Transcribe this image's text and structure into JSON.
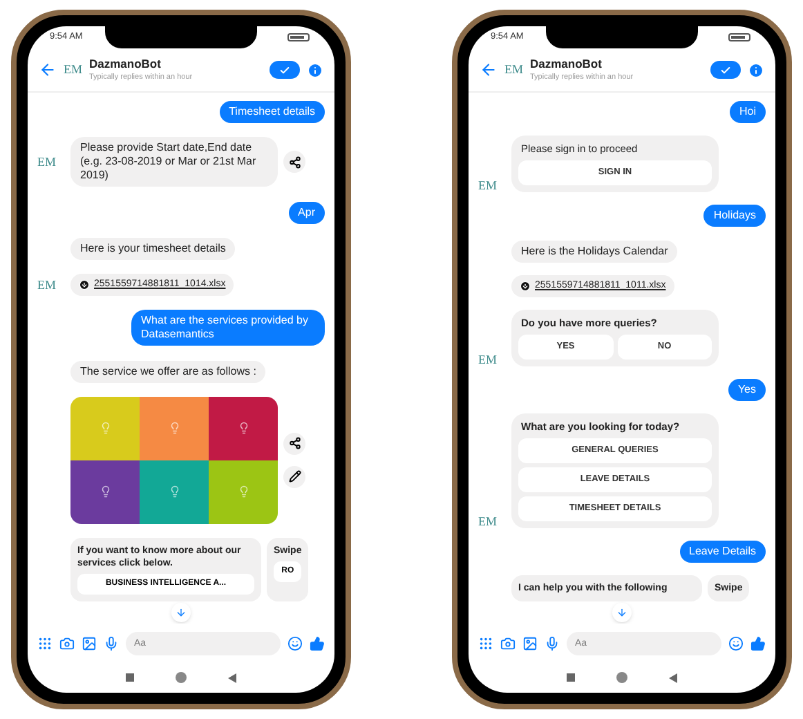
{
  "phones": [
    {
      "status_time": "9:54 AM",
      "header": {
        "logo": "EM",
        "name": "DazmanoBot",
        "subtitle": "Typically replies within an hour"
      },
      "messages": [
        {
          "kind": "user",
          "text": "Timesheet details"
        },
        {
          "kind": "bot_text",
          "text": "Please provide Start date,End date (e.g. 23-08-2019 or Mar or 21st Mar 2019)",
          "avatar": "EM",
          "share": true
        },
        {
          "kind": "user",
          "text": "Apr"
        },
        {
          "kind": "bot_text",
          "text": "Here is your timesheet details"
        },
        {
          "kind": "file",
          "text": "2551559714881811_1014.xlsx",
          "avatar": "EM"
        },
        {
          "kind": "user",
          "text": "What are the services provided by Datasemantics"
        },
        {
          "kind": "bot_text",
          "text": "The service we offer are as follows :"
        },
        {
          "kind": "image_grid",
          "share": true,
          "edit": true,
          "tiles": [
            {
              "color": "#d8cb1c"
            },
            {
              "color": "#f58a44"
            },
            {
              "color": "#c11a45"
            },
            {
              "color": "#6b3b9e"
            },
            {
              "color": "#12a896"
            },
            {
              "color": "#9cc514"
            }
          ]
        },
        {
          "kind": "carousel",
          "cards": [
            {
              "text": "If you want to know more about our services click below.",
              "button": "BUSINESS INTELLIGENCE A..."
            },
            {
              "text": "Swipe",
              "button": "RO"
            }
          ]
        }
      ],
      "composer": {
        "placeholder": "Aa"
      }
    },
    {
      "status_time": "9:54 AM",
      "header": {
        "logo": "EM",
        "name": "DazmanoBot",
        "subtitle": "Typically replies within an hour"
      },
      "messages": [
        {
          "kind": "user",
          "text": "Hoi"
        },
        {
          "kind": "choice_stack",
          "title": "Please sign in to proceed",
          "bold_title": false,
          "buttons": [
            "SIGN IN"
          ],
          "avatar": "EM"
        },
        {
          "kind": "user",
          "text": "Holidays"
        },
        {
          "kind": "bot_text",
          "text": "Here is the Holidays Calendar"
        },
        {
          "kind": "file",
          "text": "2551559714881811_1011.xlsx"
        },
        {
          "kind": "choice_row",
          "title": "Do you have more queries?",
          "bold_title": true,
          "buttons": [
            "YES",
            "NO"
          ],
          "avatar": "EM"
        },
        {
          "kind": "user",
          "text": "Yes"
        },
        {
          "kind": "choice_stack",
          "title": "What are you looking for today?",
          "bold_title": true,
          "buttons": [
            "GENERAL QUERIES",
            "LEAVE DETAILS",
            "TIMESHEET DETAILS"
          ],
          "avatar": "EM"
        },
        {
          "kind": "user",
          "text": "Leave Details"
        },
        {
          "kind": "carousel",
          "cards": [
            {
              "text": "I can help you with the following"
            },
            {
              "text": "Swipe"
            }
          ]
        }
      ],
      "composer": {
        "placeholder": "Aa"
      }
    }
  ]
}
